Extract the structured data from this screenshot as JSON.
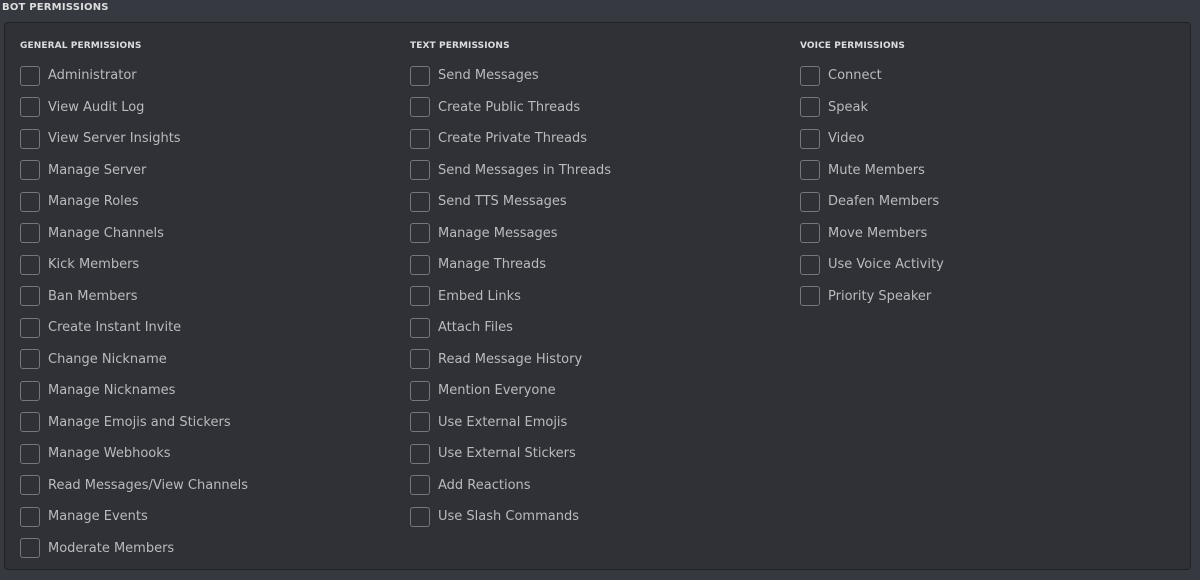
{
  "title": "BOT PERMISSIONS",
  "columns": {
    "general": {
      "header": "GENERAL PERMISSIONS",
      "items": [
        "Administrator",
        "View Audit Log",
        "View Server Insights",
        "Manage Server",
        "Manage Roles",
        "Manage Channels",
        "Kick Members",
        "Ban Members",
        "Create Instant Invite",
        "Change Nickname",
        "Manage Nicknames",
        "Manage Emojis and Stickers",
        "Manage Webhooks",
        "Read Messages/View Channels",
        "Manage Events",
        "Moderate Members"
      ]
    },
    "text": {
      "header": "TEXT PERMISSIONS",
      "items": [
        "Send Messages",
        "Create Public Threads",
        "Create Private Threads",
        "Send Messages in Threads",
        "Send TTS Messages",
        "Manage Messages",
        "Manage Threads",
        "Embed Links",
        "Attach Files",
        "Read Message History",
        "Mention Everyone",
        "Use External Emojis",
        "Use External Stickers",
        "Add Reactions",
        "Use Slash Commands"
      ]
    },
    "voice": {
      "header": "VOICE PERMISSIONS",
      "items": [
        "Connect",
        "Speak",
        "Video",
        "Mute Members",
        "Deafen Members",
        "Move Members",
        "Use Voice Activity",
        "Priority Speaker"
      ]
    }
  },
  "checked": false,
  "colors": {
    "background": "#36393f",
    "panel": "#2f3136",
    "text": "#b9bbbe",
    "header": "#dcddde",
    "checkbox_border": "#72767d"
  }
}
